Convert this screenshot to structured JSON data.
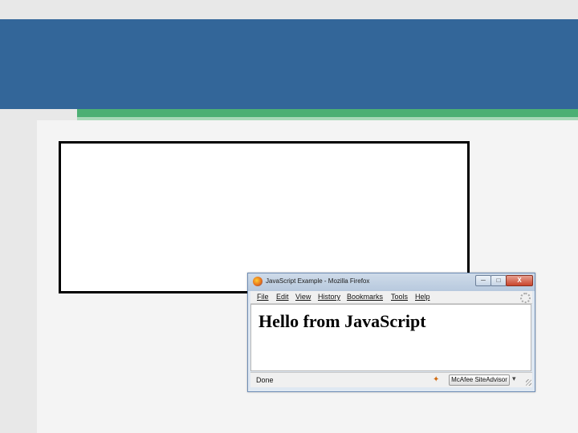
{
  "window": {
    "title": "JavaScript Example - Mozilla Firefox",
    "controls": {
      "minimize": "─",
      "maximize": "□",
      "close": "X"
    }
  },
  "menubar": {
    "items": [
      {
        "label": "File"
      },
      {
        "label": "Edit"
      },
      {
        "label": "View"
      },
      {
        "label": "History"
      },
      {
        "label": "Bookmarks"
      },
      {
        "label": "Tools"
      },
      {
        "label": "Help"
      }
    ]
  },
  "page": {
    "heading": "Hello from JavaScript"
  },
  "statusbar": {
    "status": "Done",
    "siteadvisor_label": "McAfee SiteAdvisor",
    "siteadvisor_icon_glyph": "✦",
    "dropdown_glyph": "▾"
  },
  "colors": {
    "slide_band": "#336699",
    "slide_accent": "#4caf74"
  }
}
